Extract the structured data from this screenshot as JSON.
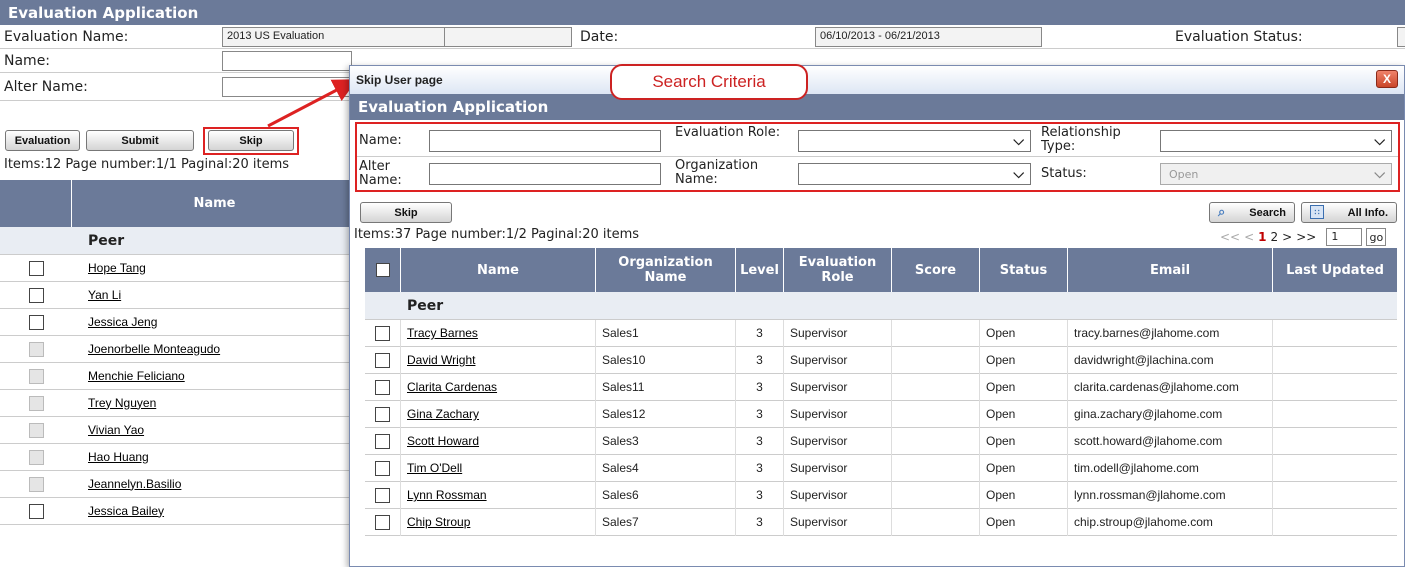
{
  "background": {
    "title": "Evaluation Application",
    "evaluation_name_label": "Evaluation Name:",
    "evaluation_name_value": "2013 US Evaluation",
    "date_label": "Date:",
    "date_value": "06/10/2013 - 06/21/2013",
    "status_label": "Evaluation Status:",
    "name_label": "Name:",
    "alter_name_label": "Alter Name:",
    "buttons": {
      "evaluation": "Evaluation",
      "submit": "Submit",
      "skip": "Skip"
    },
    "pager_text": "Items:12  Page number:1/1  Paginal:20 items",
    "column_name": "Name",
    "group_label": "Peer",
    "rows": [
      {
        "name": "Hope Tang",
        "enabled": true
      },
      {
        "name": "Yan Li",
        "enabled": true
      },
      {
        "name": "Jessica Jeng",
        "enabled": true
      },
      {
        "name": "Joenorbelle Monteagudo",
        "enabled": false
      },
      {
        "name": "Menchie Feliciano",
        "enabled": false
      },
      {
        "name": "Trey Nguyen",
        "enabled": false
      },
      {
        "name": "Vivian Yao",
        "enabled": false
      },
      {
        "name": "Hao Huang",
        "enabled": false
      },
      {
        "name": "Jeannelyn.Basilio",
        "enabled": false
      },
      {
        "name": "Jessica Bailey",
        "enabled": true
      }
    ]
  },
  "callout": "Search Criteria",
  "modal": {
    "window_title": "Skip User page",
    "close_glyph": "X",
    "header": "Evaluation Application",
    "criteria": {
      "name_label": "Name:",
      "eval_role_label": "Evaluation Role:",
      "relationship_label": "Relationship Type:",
      "alter_name_label": "Alter Name:",
      "org_name_label": "Organization Name:",
      "status_label": "Status:",
      "status_value": "Open"
    },
    "skip_button": "Skip",
    "search_button": "Search",
    "allinfo_button": "All Info.",
    "pager_text": "Items:37  Page number:1/2  Paginal:20 items",
    "pager_nav": {
      "first": "<<",
      "prev": "<",
      "current": "1",
      "page2": "2",
      "next": ">",
      "last": ">>",
      "goto_value": "1",
      "go": "go"
    },
    "columns": [
      "Name",
      "Organization Name",
      "Level",
      "Evaluation Role",
      "Score",
      "Status",
      "Email",
      "Last Updated"
    ],
    "group_label": "Peer",
    "rows": [
      {
        "name": "Tracy Barnes",
        "org": "Sales1",
        "level": "3",
        "role": "Supervisor",
        "score": "",
        "status": "Open",
        "email": "tracy.barnes@jlahome.com",
        "updated": ""
      },
      {
        "name": "David Wright",
        "org": "Sales10",
        "level": "3",
        "role": "Supervisor",
        "score": "",
        "status": "Open",
        "email": "davidwright@jlachina.com",
        "updated": ""
      },
      {
        "name": "Clarita Cardenas",
        "org": "Sales11",
        "level": "3",
        "role": "Supervisor",
        "score": "",
        "status": "Open",
        "email": "clarita.cardenas@jlahome.com",
        "updated": ""
      },
      {
        "name": "Gina Zachary",
        "org": "Sales12",
        "level": "3",
        "role": "Supervisor",
        "score": "",
        "status": "Open",
        "email": "gina.zachary@jlahome.com",
        "updated": ""
      },
      {
        "name": "Scott Howard",
        "org": "Sales3",
        "level": "3",
        "role": "Supervisor",
        "score": "",
        "status": "Open",
        "email": "scott.howard@jlahome.com",
        "updated": ""
      },
      {
        "name": "Tim O'Dell",
        "org": "Sales4",
        "level": "3",
        "role": "Supervisor",
        "score": "",
        "status": "Open",
        "email": "tim.odell@jlahome.com",
        "updated": ""
      },
      {
        "name": "Lynn Rossman",
        "org": "Sales6",
        "level": "3",
        "role": "Supervisor",
        "score": "",
        "status": "Open",
        "email": "lynn.rossman@jlahome.com",
        "updated": ""
      },
      {
        "name": "Chip Stroup",
        "org": "Sales7",
        "level": "3",
        "role": "Supervisor",
        "score": "",
        "status": "Open",
        "email": "chip.stroup@jlahome.com",
        "updated": ""
      }
    ]
  },
  "colors": {
    "header_bg": "#6b7a99",
    "highlight_red": "#d22222",
    "pager_current": "#c00000"
  }
}
